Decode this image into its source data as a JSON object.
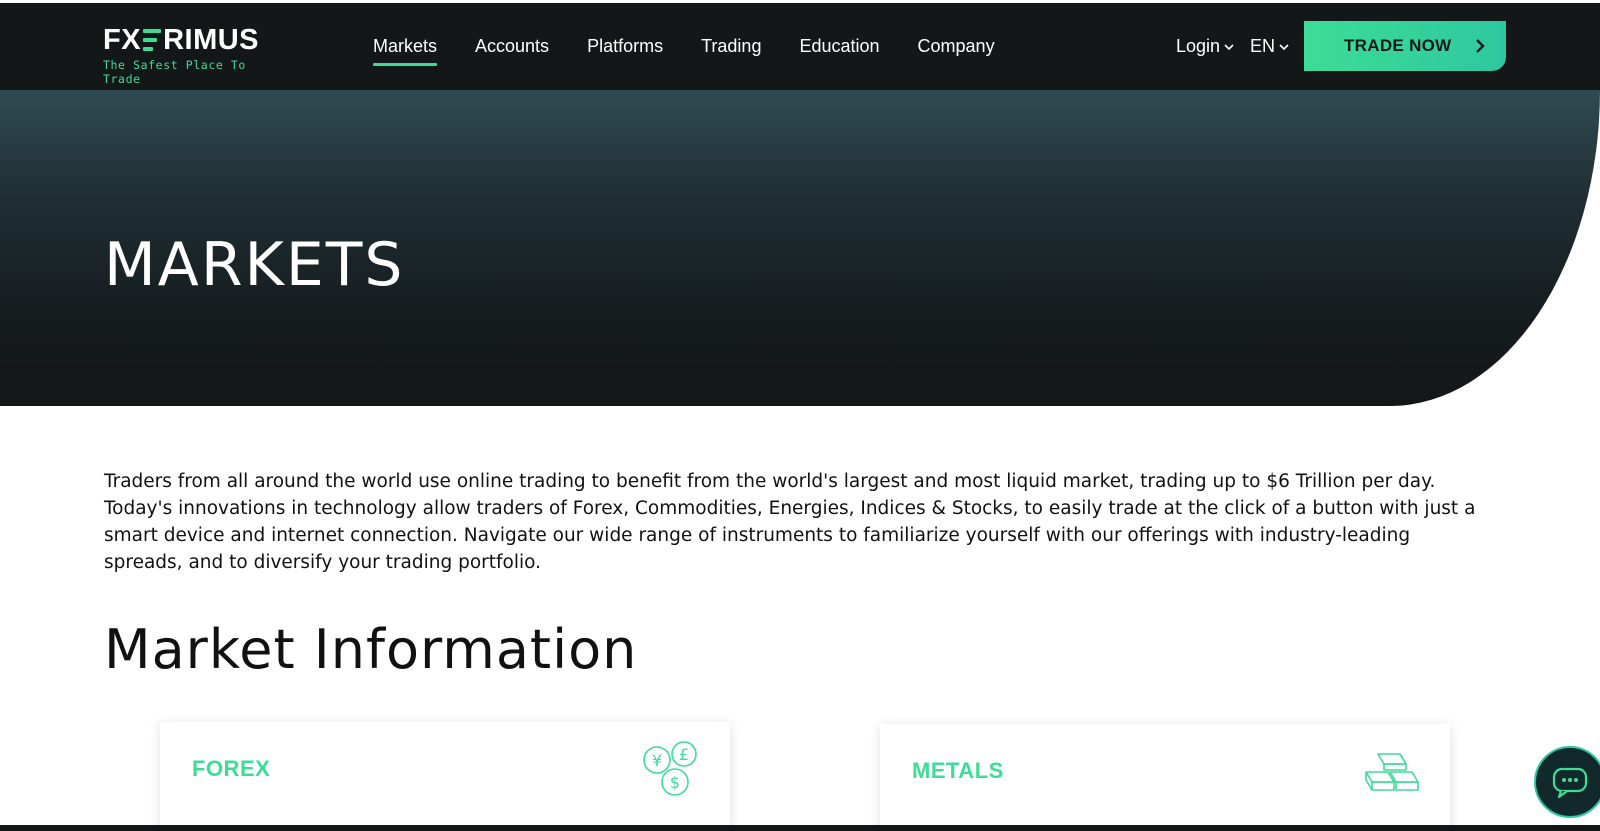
{
  "brand": {
    "name_left": "FX",
    "name_right": "RIMUS",
    "tagline": "The Safest Place To Trade",
    "accent_color": "#3ddc97"
  },
  "nav": {
    "items": [
      {
        "label": "Markets",
        "active": true
      },
      {
        "label": "Accounts",
        "active": false
      },
      {
        "label": "Platforms",
        "active": false
      },
      {
        "label": "Trading",
        "active": false
      },
      {
        "label": "Education",
        "active": false
      },
      {
        "label": "Company",
        "active": false
      }
    ],
    "login_label": "Login",
    "language_label": "EN",
    "cta_label": "TRADE NOW"
  },
  "hero": {
    "title": "MARKETS"
  },
  "intro": {
    "text": "Traders from all around the world use online trading to benefit from the world's largest and most liquid market, trading up to $6 Trillion per day. Today's innovations in technology allow traders of Forex, Commodities, Energies, Indices & Stocks, to easily trade at the click of a button with just a smart device and internet connection. Navigate our wide range of instruments to familiarize yourself with our offerings with industry-leading spreads, and to diversify your trading portfolio."
  },
  "market_info": {
    "title": "Market Information",
    "cards": [
      {
        "label": "FOREX",
        "icon": "currency-coins-icon"
      },
      {
        "label": "METALS",
        "icon": "gold-bars-icon"
      }
    ]
  },
  "chat": {
    "icon": "chat-bubble-icon"
  }
}
